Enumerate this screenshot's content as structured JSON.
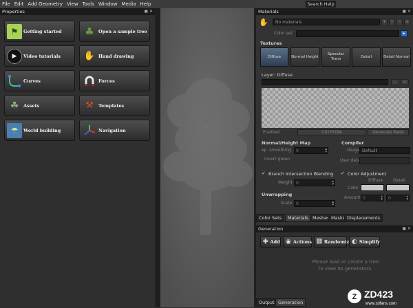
{
  "menu": [
    "File",
    "Edit",
    "Add Geometry",
    "View",
    "Tools",
    "Window",
    "Media",
    "Help"
  ],
  "search_help": "Search Help",
  "properties": {
    "title": "Properties",
    "buttons": [
      {
        "label": "Getting started",
        "icon": "getting-started-icon",
        "glyph": "⚑",
        "color": "#a7d35a"
      },
      {
        "label": "Open a sample tree",
        "icon": "tree-icon",
        "glyph": "♣",
        "color": "#4a6b2a"
      },
      {
        "label": "Video tutorials",
        "icon": "play-icon",
        "glyph": "▶",
        "color": "#202020"
      },
      {
        "label": "Hand drawing",
        "icon": "hand-icon",
        "glyph": "✋",
        "color": "#c99a76"
      },
      {
        "label": "Curves",
        "icon": "curves-icon",
        "glyph": "⌇",
        "color": "#2a7a7a"
      },
      {
        "label": "Forces",
        "icon": "magnet-icon",
        "glyph": "∩",
        "color": "#d2d2d2"
      },
      {
        "label": "Assets",
        "icon": "assets-icon",
        "glyph": "☘",
        "color": "#5a7a4a"
      },
      {
        "label": "Templates",
        "icon": "templates-icon",
        "glyph": "⚒",
        "color": "#c24a2a"
      },
      {
        "label": "World building",
        "icon": "world-icon",
        "glyph": "☂",
        "color": "#6fa8d8"
      },
      {
        "label": "Navigation",
        "icon": "axes-icon",
        "glyph": "✚",
        "color": "#6a6a6a"
      }
    ]
  },
  "materials": {
    "title": "Materials",
    "material_select": "No materials",
    "color_set_label": "Color set",
    "textures_label": "Textures",
    "texture_tabs": [
      "Diffuse",
      "Normal Height",
      "Specular Trans",
      "Detail",
      "Detail Normal"
    ],
    "layer_label": "Layer: Diffuse",
    "enabled_label": "Enabled",
    "ctrl_rgba": "Ctrl RGBA",
    "generate_mask": "Generate Mask",
    "normal_height_map": "Normal/Height Map",
    "smoothing_label": "xp. smoothing",
    "smoothing_value": "0",
    "invert_green": "Invert green",
    "compiler_label": "Compiler",
    "usage_label": "Usage",
    "usage_value": "Default",
    "user_data_label": "User data",
    "branch_blending": "Branch Intersection Blending",
    "weight_label": "Weight",
    "weight_value": "0",
    "color_adjustment": "Color Adjustment",
    "diffuse_col": "Diffuse",
    "detail_col": "Detail",
    "color_label": "Color",
    "amount_label": "Amount",
    "amount_value_1": "0",
    "amount_value_2": "0",
    "unwrapping_label": "Unwrapping",
    "scale_label": "Scale",
    "scale_value": "0",
    "bottom_tabs": [
      "Color Sets",
      "Materials",
      "Meshes",
      "Masks",
      "Displacements"
    ]
  },
  "generation": {
    "title": "Generation",
    "buttons": [
      {
        "label": "Add",
        "icon": "plus-icon",
        "glyph": "✚"
      },
      {
        "label": "Actions",
        "icon": "actions-icon",
        "glyph": "◉"
      },
      {
        "label": "Randomize",
        "icon": "randomize-icon",
        "glyph": "⚄"
      },
      {
        "label": "Simplify",
        "icon": "simplify-icon",
        "glyph": "◐"
      }
    ],
    "message_line1": "Please load or create a tree",
    "message_line2": "to view its generators.",
    "tabs": [
      "Output",
      "Generation"
    ]
  },
  "watermark": {
    "brand": "ZD423",
    "url": "www.zdfans.com"
  }
}
